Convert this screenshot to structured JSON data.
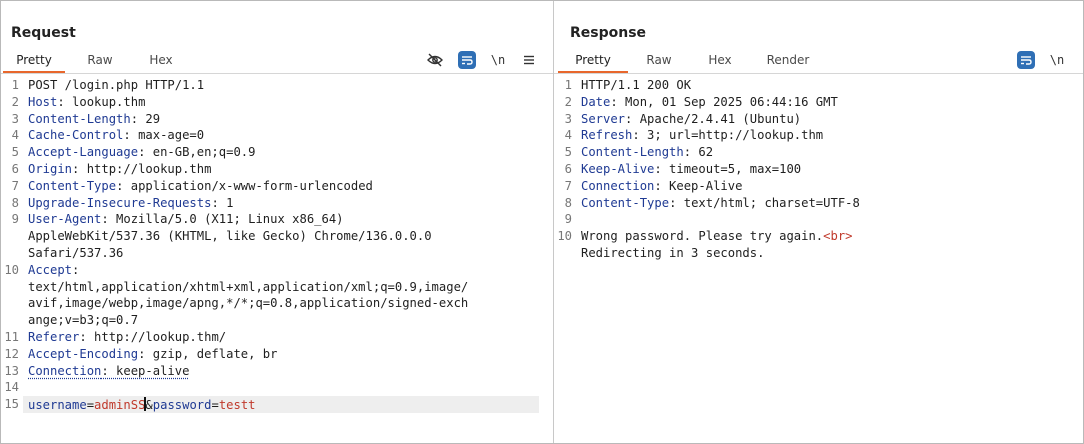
{
  "request": {
    "title": "Request",
    "tabs": [
      "Pretty",
      "Raw",
      "Hex"
    ],
    "active_tab": "Pretty",
    "newline_label": "\\n",
    "lines": [
      {
        "n": "1",
        "parts": [
          {
            "t": "POST /login.php HTTP/1.1",
            "c": "plain"
          }
        ]
      },
      {
        "n": "2",
        "parts": [
          {
            "t": "Host",
            "c": "hk"
          },
          {
            "t": ": lookup.thm",
            "c": "plain"
          }
        ]
      },
      {
        "n": "3",
        "parts": [
          {
            "t": "Content-Length",
            "c": "hk"
          },
          {
            "t": ": 29",
            "c": "plain"
          }
        ]
      },
      {
        "n": "4",
        "parts": [
          {
            "t": "Cache-Control",
            "c": "hk"
          },
          {
            "t": ": max-age=0",
            "c": "plain"
          }
        ]
      },
      {
        "n": "5",
        "parts": [
          {
            "t": "Accept-Language",
            "c": "hk"
          },
          {
            "t": ": en-GB,en;q=0.9",
            "c": "plain"
          }
        ]
      },
      {
        "n": "6",
        "parts": [
          {
            "t": "Origin",
            "c": "hk"
          },
          {
            "t": ": http://lookup.thm",
            "c": "plain"
          }
        ]
      },
      {
        "n": "7",
        "parts": [
          {
            "t": "Content-Type",
            "c": "hk"
          },
          {
            "t": ": application/x-www-form-urlencoded",
            "c": "plain"
          }
        ]
      },
      {
        "n": "8",
        "parts": [
          {
            "t": "Upgrade-Insecure-Requests",
            "c": "hk"
          },
          {
            "t": ": 1",
            "c": "plain"
          }
        ]
      },
      {
        "n": "9",
        "parts": [
          {
            "t": "User-Agent",
            "c": "hk"
          },
          {
            "t": ": Mozilla/5.0 (X11; Linux x86_64)",
            "c": "plain"
          }
        ]
      },
      {
        "n": "",
        "parts": [
          {
            "t": "AppleWebKit/537.36 (KHTML, like Gecko) Chrome/136.0.0.0",
            "c": "plain"
          }
        ]
      },
      {
        "n": "",
        "parts": [
          {
            "t": "Safari/537.36",
            "c": "plain"
          }
        ]
      },
      {
        "n": "10",
        "parts": [
          {
            "t": "Accept",
            "c": "hk"
          },
          {
            "t": ":",
            "c": "plain"
          }
        ]
      },
      {
        "n": "",
        "parts": [
          {
            "t": "text/html,application/xhtml+xml,application/xml;q=0.9,image/",
            "c": "plain"
          }
        ]
      },
      {
        "n": "",
        "parts": [
          {
            "t": "avif,image/webp,image/apng,*/*;q=0.8,application/signed-exch",
            "c": "plain"
          }
        ]
      },
      {
        "n": "",
        "parts": [
          {
            "t": "ange;v=b3;q=0.7",
            "c": "plain"
          }
        ]
      },
      {
        "n": "11",
        "parts": [
          {
            "t": "Referer",
            "c": "hk"
          },
          {
            "t": ": http://lookup.thm/",
            "c": "plain"
          }
        ]
      },
      {
        "n": "12",
        "parts": [
          {
            "t": "Accept-Encoding",
            "c": "hk"
          },
          {
            "t": ": gzip, deflate, br",
            "c": "plain"
          }
        ]
      },
      {
        "n": "13",
        "parts": [
          {
            "t": "Connection",
            "c": "hk dotted"
          },
          {
            "t": ": keep-alive",
            "c": "plain dotted"
          }
        ]
      },
      {
        "n": "14",
        "parts": []
      },
      {
        "n": "15",
        "parts": [
          {
            "t": "username",
            "c": "pk"
          },
          {
            "t": "=",
            "c": "plain"
          },
          {
            "t": "adminSS",
            "c": "pv"
          },
          {
            "t": "CARET",
            "c": "caret"
          },
          {
            "t": "&",
            "c": "plain"
          },
          {
            "t": "password",
            "c": "pk"
          },
          {
            "t": "=",
            "c": "plain"
          },
          {
            "t": "testt",
            "c": "pv"
          }
        ]
      }
    ]
  },
  "response": {
    "title": "Response",
    "tabs": [
      "Pretty",
      "Raw",
      "Hex",
      "Render"
    ],
    "active_tab": "Pretty",
    "newline_label": "\\n",
    "lines": [
      {
        "n": "1",
        "parts": [
          {
            "t": "HTTP/1.1 200 OK",
            "c": "plain"
          }
        ]
      },
      {
        "n": "2",
        "parts": [
          {
            "t": "Date",
            "c": "hk"
          },
          {
            "t": ": Mon, 01 Sep 2025 06:44:16 GMT",
            "c": "plain"
          }
        ]
      },
      {
        "n": "3",
        "parts": [
          {
            "t": "Server",
            "c": "hk"
          },
          {
            "t": ": Apache/2.4.41 (Ubuntu)",
            "c": "plain"
          }
        ]
      },
      {
        "n": "4",
        "parts": [
          {
            "t": "Refresh",
            "c": "hk"
          },
          {
            "t": ": 3; url=http://lookup.thm",
            "c": "plain"
          }
        ]
      },
      {
        "n": "5",
        "parts": [
          {
            "t": "Content-Length",
            "c": "hk"
          },
          {
            "t": ": 62",
            "c": "plain"
          }
        ]
      },
      {
        "n": "6",
        "parts": [
          {
            "t": "Keep-Alive",
            "c": "hk"
          },
          {
            "t": ": timeout=5, max=100",
            "c": "plain"
          }
        ]
      },
      {
        "n": "7",
        "parts": [
          {
            "t": "Connection",
            "c": "hk"
          },
          {
            "t": ": Keep-Alive",
            "c": "plain"
          }
        ]
      },
      {
        "n": "8",
        "parts": [
          {
            "t": "Content-Type",
            "c": "hk"
          },
          {
            "t": ": text/html; charset=UTF-8",
            "c": "plain"
          }
        ]
      },
      {
        "n": "9",
        "parts": []
      },
      {
        "n": "10",
        "parts": [
          {
            "t": "Wrong password. Please try again.",
            "c": "plain"
          },
          {
            "t": "<br>",
            "c": "tag"
          }
        ]
      },
      {
        "n": "",
        "parts": [
          {
            "t": "Redirecting in 3 seconds.",
            "c": "plain"
          }
        ]
      }
    ]
  },
  "colors": {
    "accent_tab": "#e8672c",
    "toggle_blue": "#2f6fb5",
    "header_key": "#1f3a93",
    "param_value": "#c0392b"
  },
  "icons": [
    "hide-icon",
    "wrap-icon",
    "newline-icon",
    "menu-icon",
    "layout-split-icon",
    "layout-rows-icon"
  ]
}
